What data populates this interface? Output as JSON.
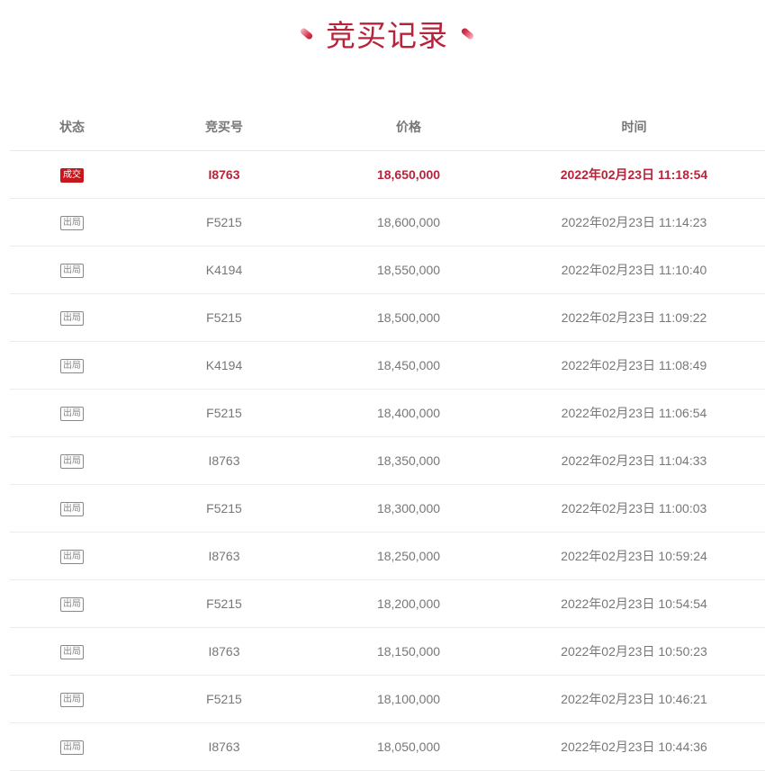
{
  "page": {
    "title": "竞买记录"
  },
  "table": {
    "headers": {
      "status": "状态",
      "bid_no": "竞买号",
      "price": "价格",
      "time": "时间"
    },
    "rows": [
      {
        "status": "成交",
        "bid_no": "I8763",
        "price": "18,650,000",
        "time": "2022年02月23日 11:18:54",
        "winner": true
      },
      {
        "status": "出局",
        "bid_no": "F5215",
        "price": "18,600,000",
        "time": "2022年02月23日 11:14:23",
        "winner": false
      },
      {
        "status": "出局",
        "bid_no": "K4194",
        "price": "18,550,000",
        "time": "2022年02月23日 11:10:40",
        "winner": false
      },
      {
        "status": "出局",
        "bid_no": "F5215",
        "price": "18,500,000",
        "time": "2022年02月23日 11:09:22",
        "winner": false
      },
      {
        "status": "出局",
        "bid_no": "K4194",
        "price": "18,450,000",
        "time": "2022年02月23日 11:08:49",
        "winner": false
      },
      {
        "status": "出局",
        "bid_no": "F5215",
        "price": "18,400,000",
        "time": "2022年02月23日 11:06:54",
        "winner": false
      },
      {
        "status": "出局",
        "bid_no": "I8763",
        "price": "18,350,000",
        "time": "2022年02月23日 11:04:33",
        "winner": false
      },
      {
        "status": "出局",
        "bid_no": "F5215",
        "price": "18,300,000",
        "time": "2022年02月23日 11:00:03",
        "winner": false
      },
      {
        "status": "出局",
        "bid_no": "I8763",
        "price": "18,250,000",
        "time": "2022年02月23日 10:59:24",
        "winner": false
      },
      {
        "status": "出局",
        "bid_no": "F5215",
        "price": "18,200,000",
        "time": "2022年02月23日 10:54:54",
        "winner": false
      },
      {
        "status": "出局",
        "bid_no": "I8763",
        "price": "18,150,000",
        "time": "2022年02月23日 10:50:23",
        "winner": false
      },
      {
        "status": "出局",
        "bid_no": "F5215",
        "price": "18,100,000",
        "time": "2022年02月23日 10:46:21",
        "winner": false
      },
      {
        "status": "出局",
        "bid_no": "I8763",
        "price": "18,050,000",
        "time": "2022年02月23日 10:44:36",
        "winner": false
      }
    ]
  },
  "colors": {
    "accent": "#b8233a",
    "deal_badge": "#c8161d",
    "text": "#777777",
    "divider": "#ececec"
  }
}
